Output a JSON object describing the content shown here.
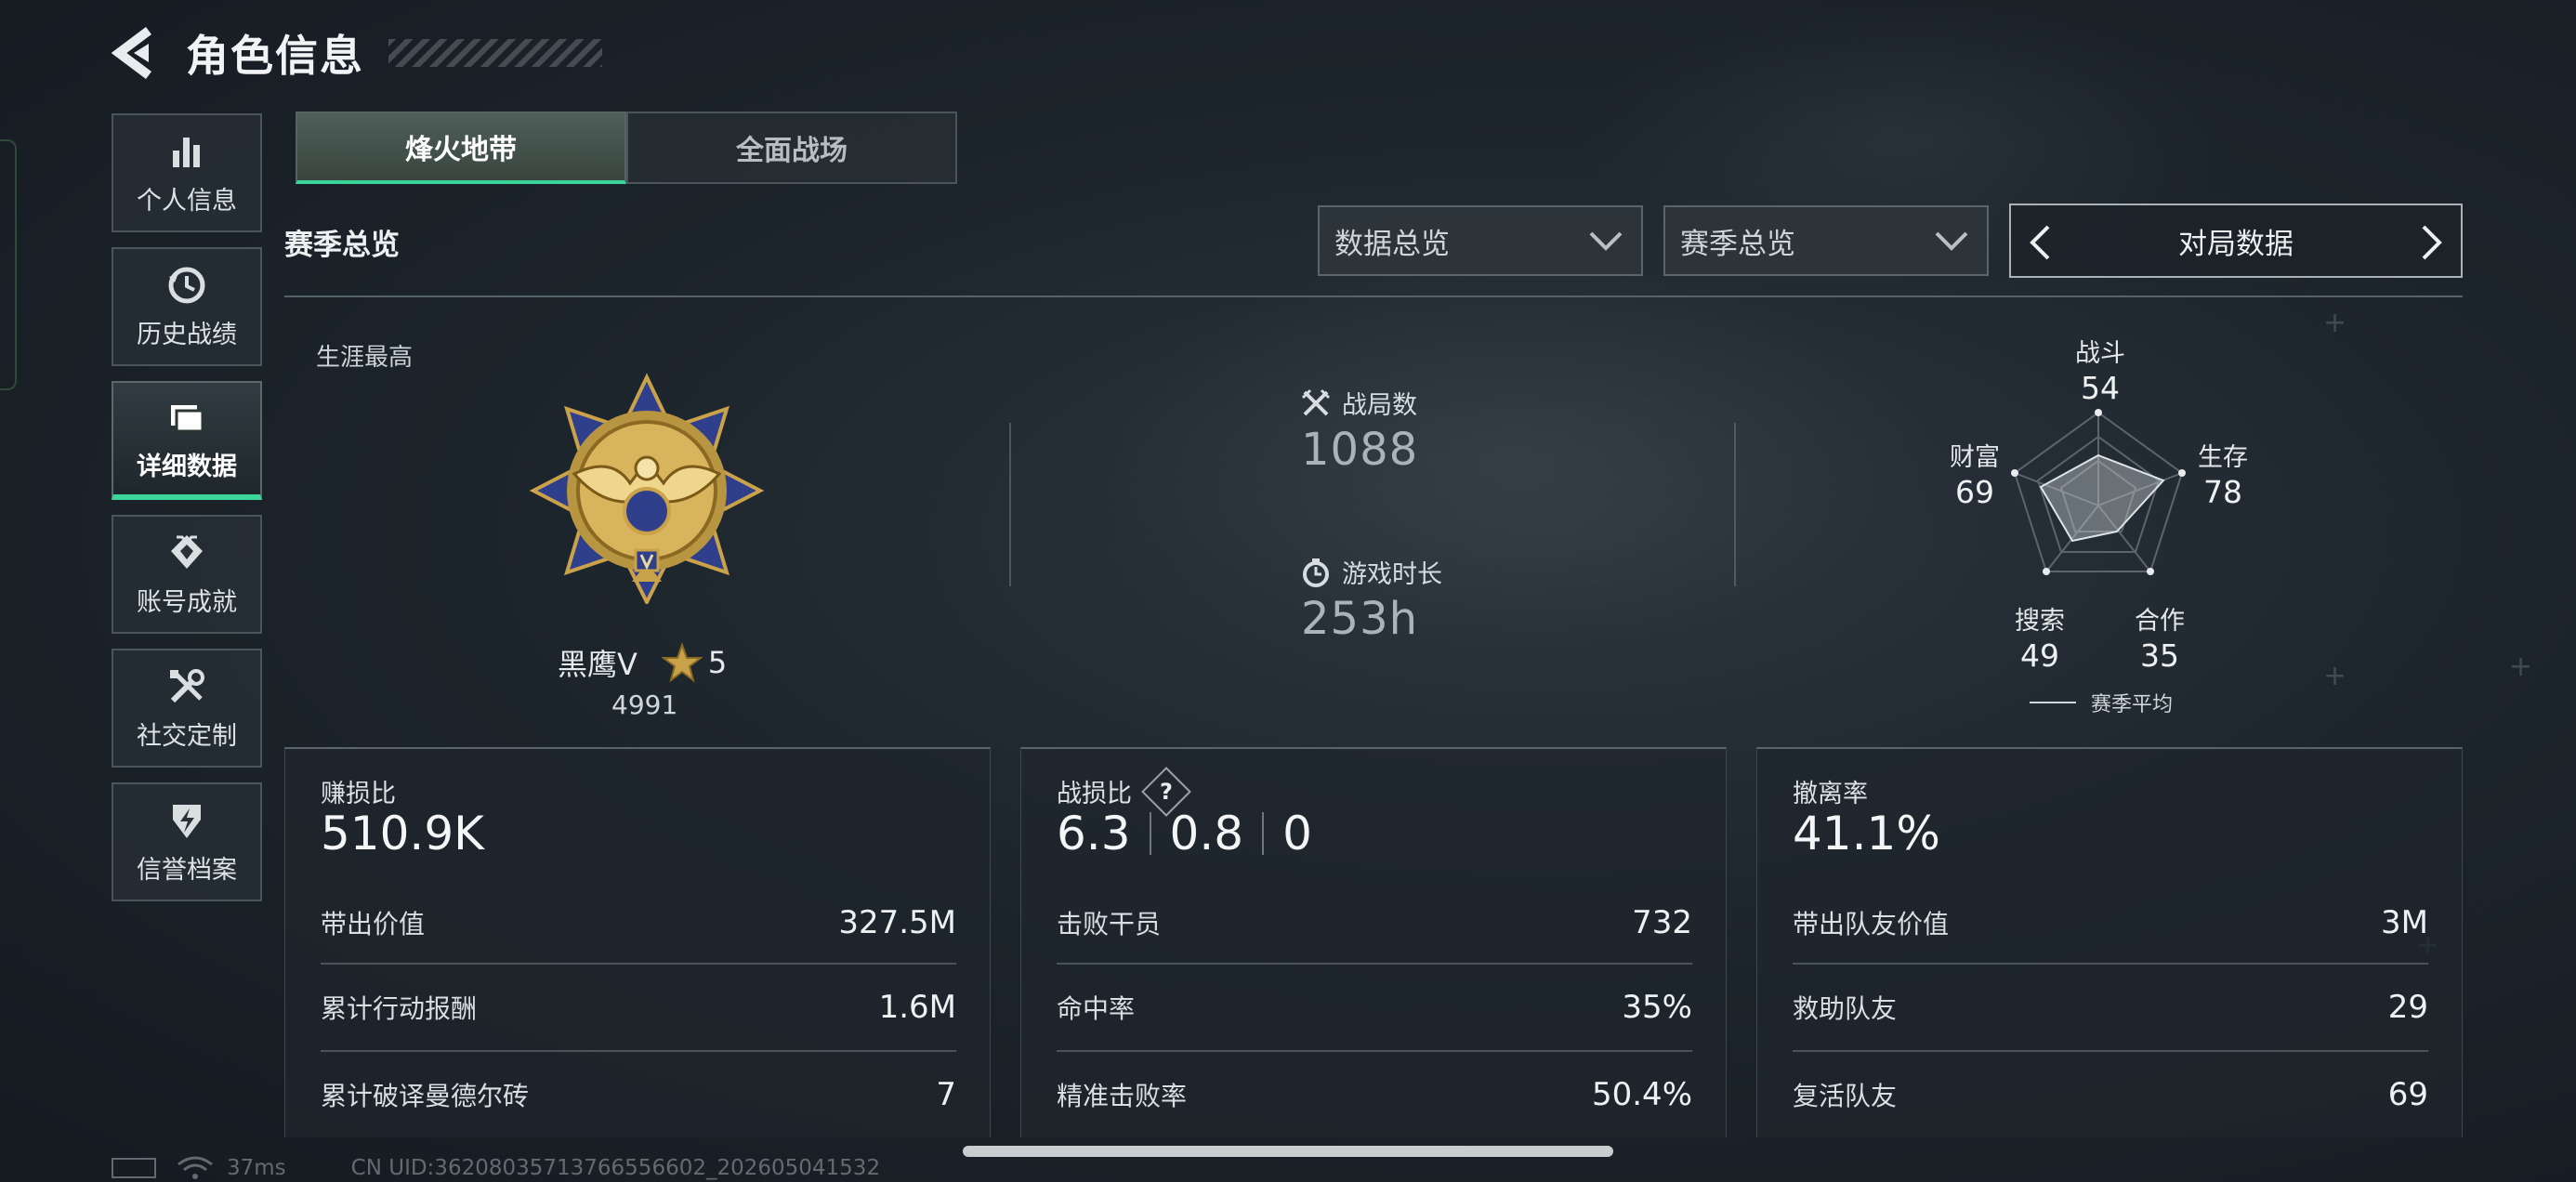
{
  "header": {
    "title": "角色信息"
  },
  "sidebar": {
    "items": [
      {
        "label": "个人信息",
        "icon": "bar-chart-icon"
      },
      {
        "label": "历史战绩",
        "icon": "clock-history-icon"
      },
      {
        "label": "详细数据",
        "icon": "folder-data-icon",
        "active": true
      },
      {
        "label": "账号成就",
        "icon": "achievement-badge-icon"
      },
      {
        "label": "社交定制",
        "icon": "wrench-tools-icon"
      },
      {
        "label": "信誉档案",
        "icon": "shield-credit-icon"
      }
    ]
  },
  "tabs": [
    {
      "label": "烽火地带",
      "active": true
    },
    {
      "label": "全面战场",
      "active": false
    }
  ],
  "section_title": "赛季总览",
  "filters": {
    "data_select": "数据总览",
    "season_select": "赛季总览",
    "pager_label": "对局数据"
  },
  "career": {
    "label": "生涯最高",
    "rank_name": "黑鹰V",
    "stars": "5",
    "score": "4991"
  },
  "stats": {
    "matches_label": "战局数",
    "matches_value": "1088",
    "playtime_label": "游戏时长",
    "playtime_value": "253h"
  },
  "radar": {
    "axes": [
      {
        "label": "战斗",
        "value": "54"
      },
      {
        "label": "生存",
        "value": "78"
      },
      {
        "label": "合作",
        "value": "35"
      },
      {
        "label": "搜索",
        "value": "49"
      },
      {
        "label": "财富",
        "value": "69"
      }
    ],
    "legend": "赛季平均"
  },
  "cards": {
    "profit": {
      "title": "赚损比",
      "big_value": "510.9K",
      "rows": [
        {
          "label": "带出价值",
          "value": "327.5M"
        },
        {
          "label": "累计行动报酬",
          "value": "1.6M"
        },
        {
          "label": "累计破译曼德尔砖",
          "value": "7"
        }
      ]
    },
    "combat": {
      "title": "战损比",
      "help": "?",
      "values": [
        "6.3",
        "0.8",
        "0"
      ],
      "rows": [
        {
          "label": "击败干员",
          "value": "732"
        },
        {
          "label": "命中率",
          "value": "35%"
        },
        {
          "label": "精准击败率",
          "value": "50.4%"
        }
      ]
    },
    "extract": {
      "title": "撤离率",
      "big_value": "41.1%",
      "rows": [
        {
          "label": "带出队友价值",
          "value": "3M"
        },
        {
          "label": "救助队友",
          "value": "29"
        },
        {
          "label": "复活队友",
          "value": "69"
        }
      ]
    }
  },
  "status_bar": {
    "ping": "37ms",
    "uid": "CN UID:36208035713766556602_202605041532"
  },
  "colors": {
    "accent": "#39d59a",
    "background": "#1d252c",
    "medal_gold": "#c9a24a",
    "medal_blue": "#2f3f8c"
  }
}
